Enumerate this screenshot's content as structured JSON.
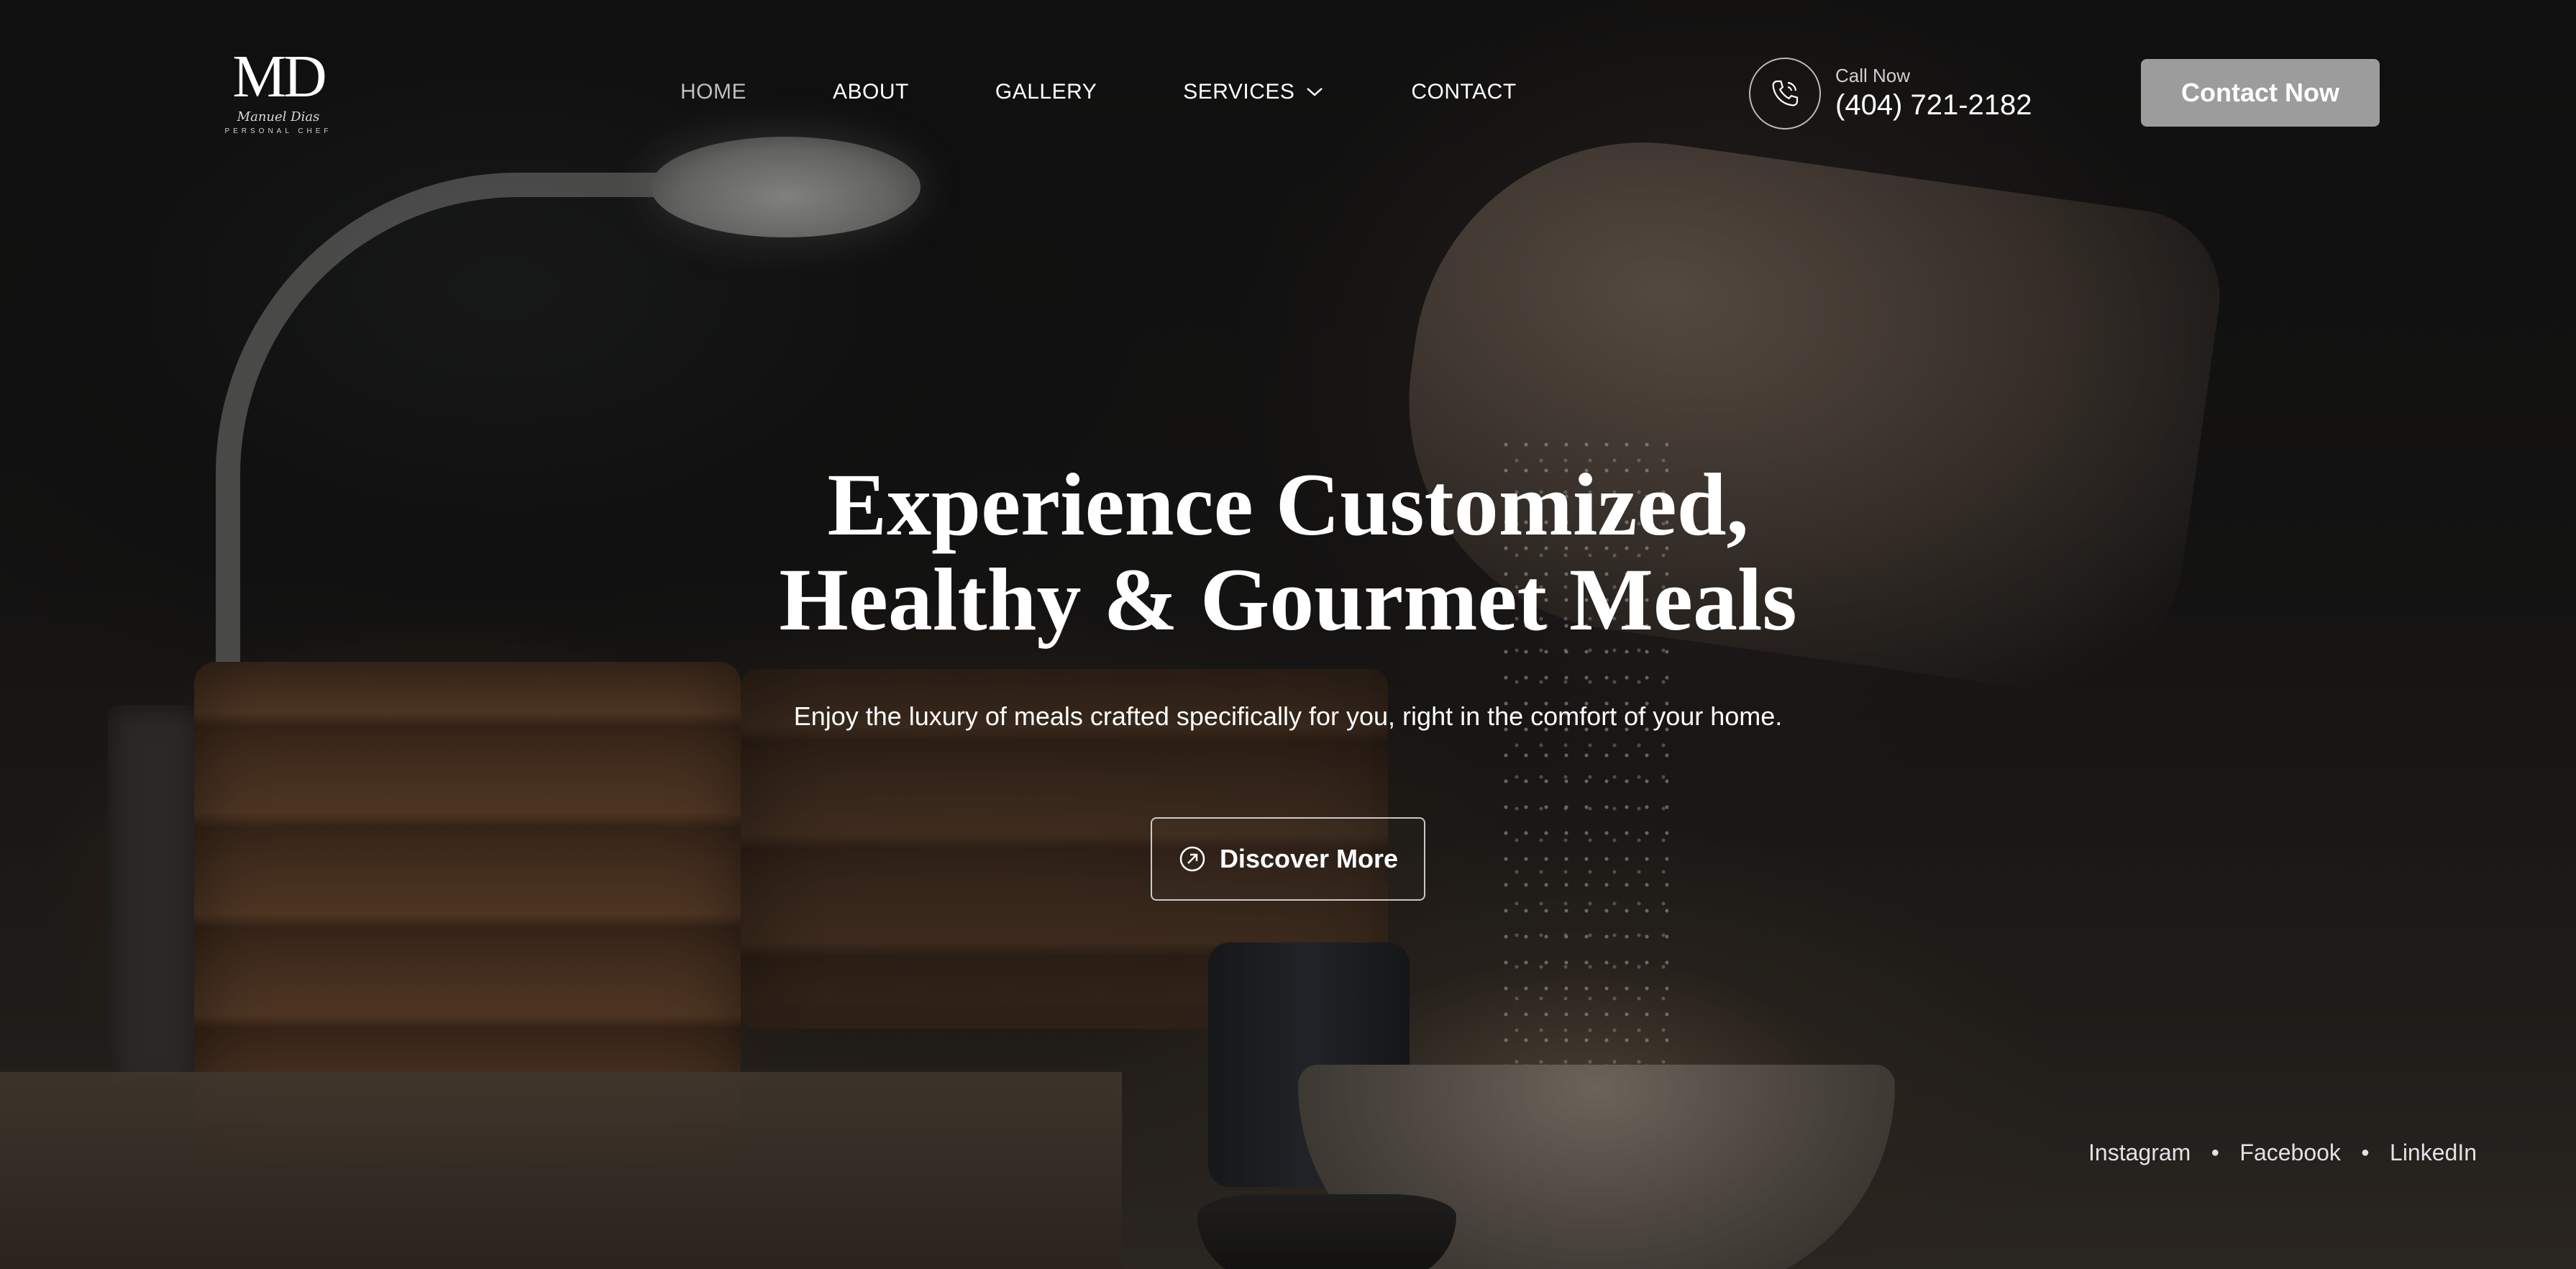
{
  "logo": {
    "mark": "MD",
    "script": "Manuel Dias",
    "subtitle": "PERSONAL CHEF"
  },
  "nav": {
    "items": [
      {
        "label": "HOME",
        "active": true
      },
      {
        "label": "ABOUT",
        "active": false
      },
      {
        "label": "GALLERY",
        "active": false
      },
      {
        "label": "SERVICES",
        "active": false,
        "has_dropdown": true
      },
      {
        "label": "CONTACT",
        "active": false
      }
    ]
  },
  "call": {
    "label": "Call Now",
    "number": "(404) 721-2182",
    "icon": "phone-icon"
  },
  "header": {
    "cta_label": "Contact Now"
  },
  "hero": {
    "headline_line1": "Experience Customized,",
    "headline_line2": "Healthy & Gourmet Meals",
    "subline": "Enjoy the luxury of meals crafted specifically for you, right in the comfort of your home.",
    "button_label": "Discover More",
    "button_icon": "arrow-up-right-circle-icon"
  },
  "social": {
    "links": [
      "Instagram",
      "Facebook",
      "LinkedIn"
    ]
  },
  "colors": {
    "cta_background": "#9c9c9c",
    "text": "#ffffff",
    "nav_active": "#bdbdbd"
  }
}
